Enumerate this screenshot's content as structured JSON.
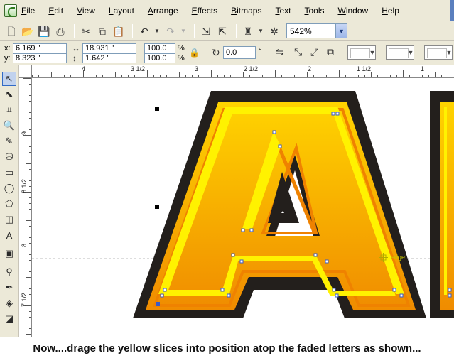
{
  "menu": {
    "items": [
      "File",
      "Edit",
      "View",
      "Layout",
      "Arrange",
      "Effects",
      "Bitmaps",
      "Text",
      "Tools",
      "Window",
      "Help"
    ]
  },
  "toolbar": {
    "icons": [
      "new-icon",
      "open-icon",
      "save-icon",
      "print-icon",
      "cut-icon",
      "copy-icon",
      "paste-icon",
      "undo-icon",
      "redo-icon",
      "import-icon",
      "export-icon",
      "application-launcher-icon",
      "welcome-screen-icon"
    ],
    "zoom_value": "542%"
  },
  "property_bar": {
    "x_label": "x:",
    "x_value": "6.169 \"",
    "y_label": "y:",
    "y_value": "8.323 \"",
    "width_value": "18.931 \"",
    "height_value": "1.642 \"",
    "scale_w": "100.0",
    "scale_h": "100.0",
    "percent_symbol": "%",
    "rotation_value": "0.0",
    "degree_symbol": "°"
  },
  "rulers": {
    "horizontal_labels": [
      "4",
      "3 1/2",
      "3",
      "2 1/2",
      "2",
      "1 1/2",
      "1"
    ],
    "vertical_labels": [
      "9",
      "8 1/2",
      "8",
      "7 1/2"
    ]
  },
  "toolbox": {
    "tools": [
      "pick-tool-icon",
      "shape-tool-icon",
      "crop-tool-icon",
      "zoom-tool-icon",
      "freehand-tool-icon",
      "smart-fill-tool-icon",
      "rectangle-tool-icon",
      "ellipse-tool-icon",
      "polygon-tool-icon",
      "basic-shapes-tool-icon",
      "text-tool-icon",
      "interactive-blend-tool-icon",
      "eyedropper-tool-icon",
      "outline-tool-icon",
      "fill-tool-icon",
      "interactive-fill-tool-icon"
    ]
  },
  "canvas": {
    "snap_label": "edge",
    "colors": {
      "outline_dark": "#231f1c",
      "gold_top": "#ffd400",
      "orange_bottom": "#f08c00",
      "yellow_slice": "#fff200",
      "orange_border": "#ef8200",
      "node": "#3a5bc7"
    }
  },
  "caption": {
    "text": "Now....drage the yellow slices into position atop the faded letters as shown..."
  }
}
